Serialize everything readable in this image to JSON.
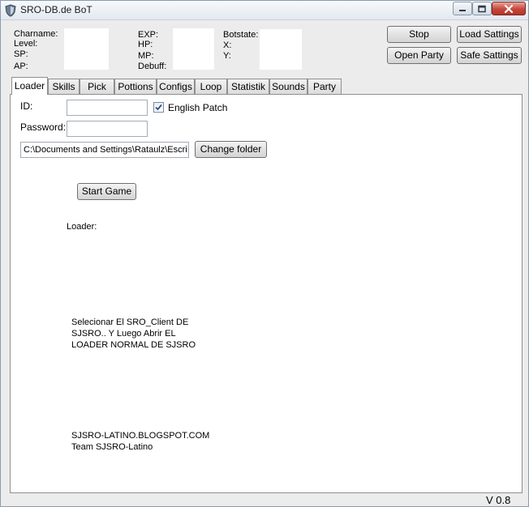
{
  "window": {
    "title": "SRO-DB.de BoT"
  },
  "info": {
    "charname_label": "Charname:",
    "level_label": "Level:",
    "sp_label": "SP:",
    "ap_label": "AP:",
    "exp_label": "EXP:",
    "hp_label": "HP:",
    "mp_label": "MP:",
    "debuff_label": "Debuff:",
    "botstate_label": "Botstate:",
    "x_label": "X:",
    "y_label": "Y:"
  },
  "buttons": {
    "stop": "Stop",
    "load_settings": "Load Sattings",
    "open_party": "Open Party",
    "save_settings": "Safe Sattings"
  },
  "tabs": [
    {
      "label": "Loader"
    },
    {
      "label": "Skills"
    },
    {
      "label": "Pick"
    },
    {
      "label": "Pottions"
    },
    {
      "label": "Configs"
    },
    {
      "label": "Loop"
    },
    {
      "label": "Statistik"
    },
    {
      "label": "Sounds"
    },
    {
      "label": "Party"
    }
  ],
  "loader": {
    "id_label": "ID:",
    "id_value": "",
    "password_label": "Password:",
    "password_value": "",
    "english_patch_label": "English Patch",
    "english_patch_checked": true,
    "folder_path": "C:\\Documents and Settings\\Rataulz\\Escri",
    "change_folder_button": "Change folder",
    "start_game_button": "Start Game",
    "status_label": "Loader:",
    "note_line1": "Selecionar El SRO_Client DE",
    "note_line2": "SJSRO.. Y Luego Abrir EL",
    "note_line3": "LOADER NORMAL DE SJSRO",
    "credit_line1": "SJSRO-LATINO.BLOGSPOT.COM",
    "credit_line2": "Team SJSRO-Latino"
  },
  "footer": {
    "version": "V 0.8"
  }
}
